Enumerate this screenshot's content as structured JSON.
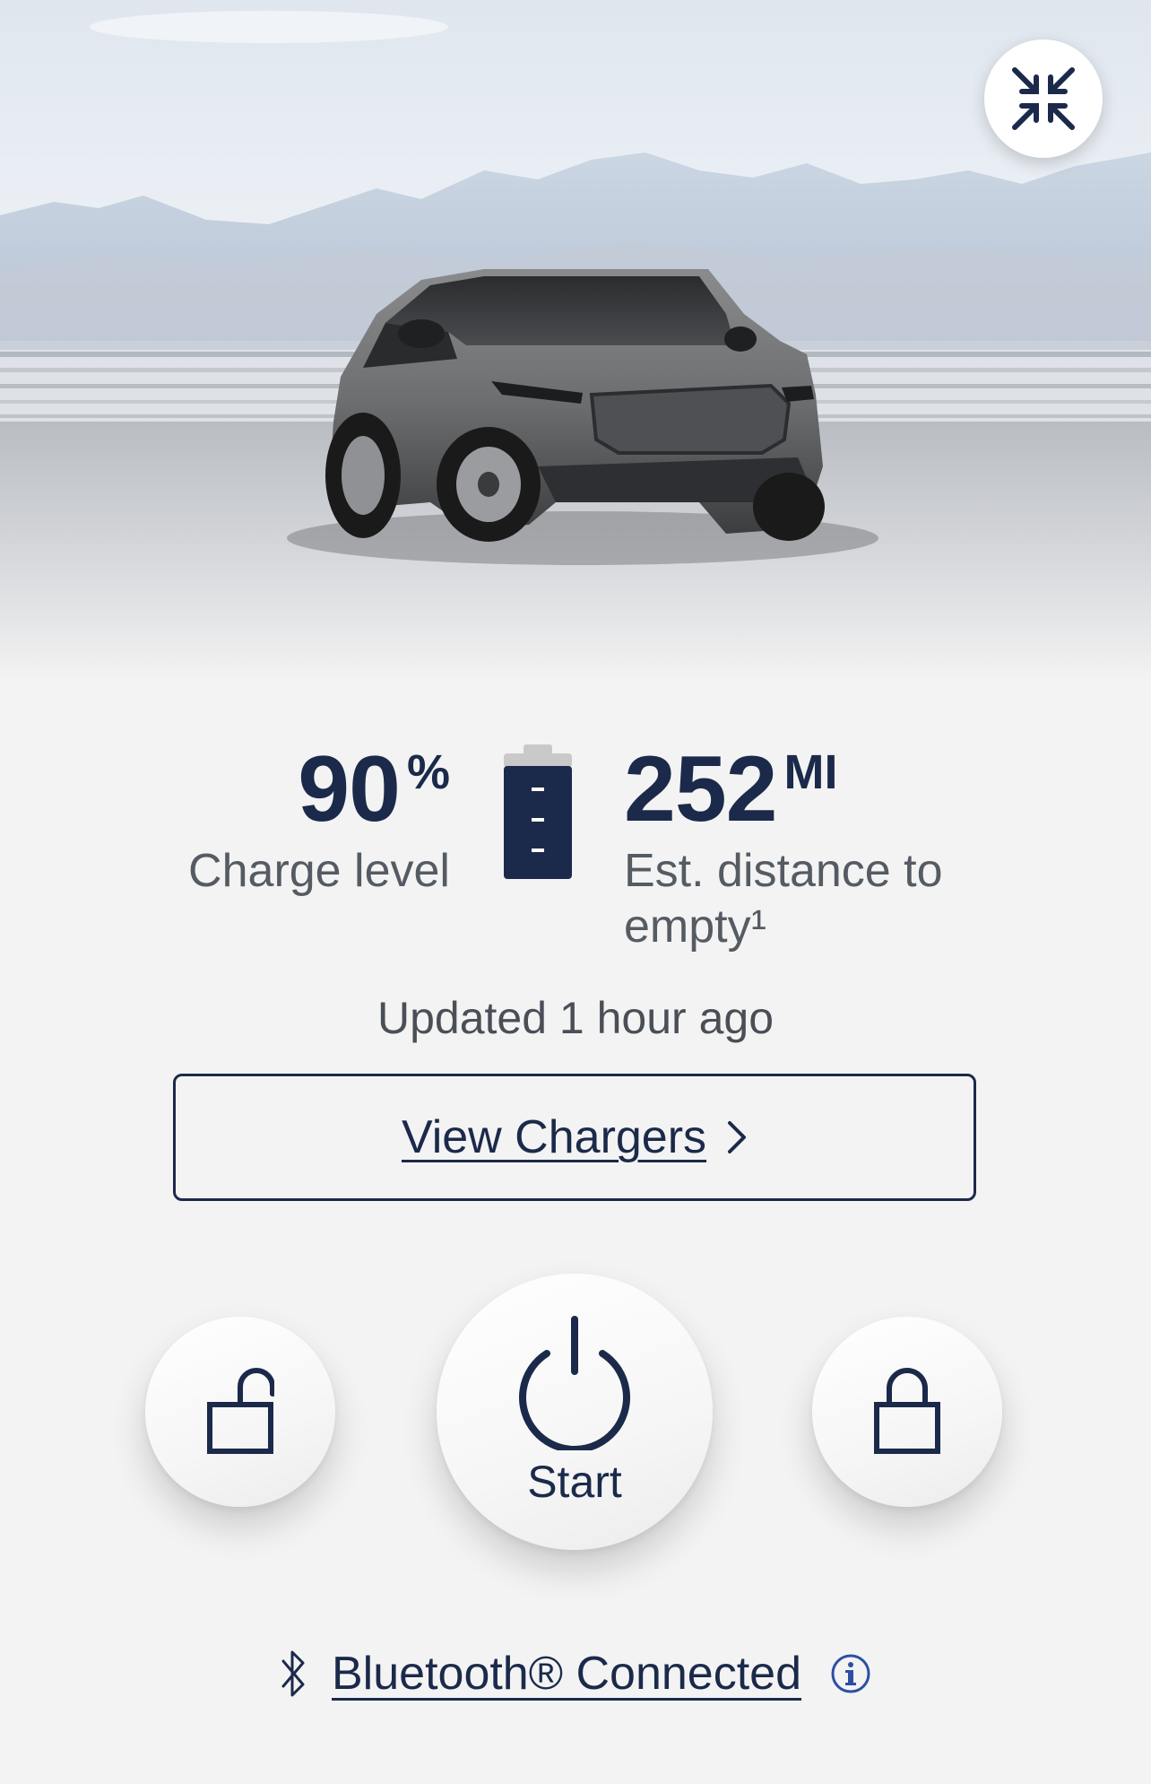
{
  "hero": {
    "collapse_icon": "collapse-arrows-icon",
    "vehicle_image": "electric-suv-photo"
  },
  "charge": {
    "value": "90",
    "unit": "%",
    "label": "Charge level",
    "level_fraction": 0.9
  },
  "battery_icon": "battery-level-icon",
  "range": {
    "value": "252",
    "unit": "MI",
    "label": "Est. distance to empty¹"
  },
  "updated_text": "Updated 1 hour ago",
  "view_chargers": {
    "label": "View Chargers",
    "icon": "chevron-right-icon"
  },
  "actions": {
    "unlock_icon": "unlock-icon",
    "start_icon": "power-icon",
    "start_label": "Start",
    "lock_icon": "lock-icon"
  },
  "bluetooth": {
    "icon": "bluetooth-icon",
    "label": "Bluetooth® Connected",
    "info_icon": "info-icon"
  },
  "colors": {
    "brand_navy": "#1b2a4a",
    "background": "#f3f3f3",
    "link_blue": "#2d4fa3"
  }
}
